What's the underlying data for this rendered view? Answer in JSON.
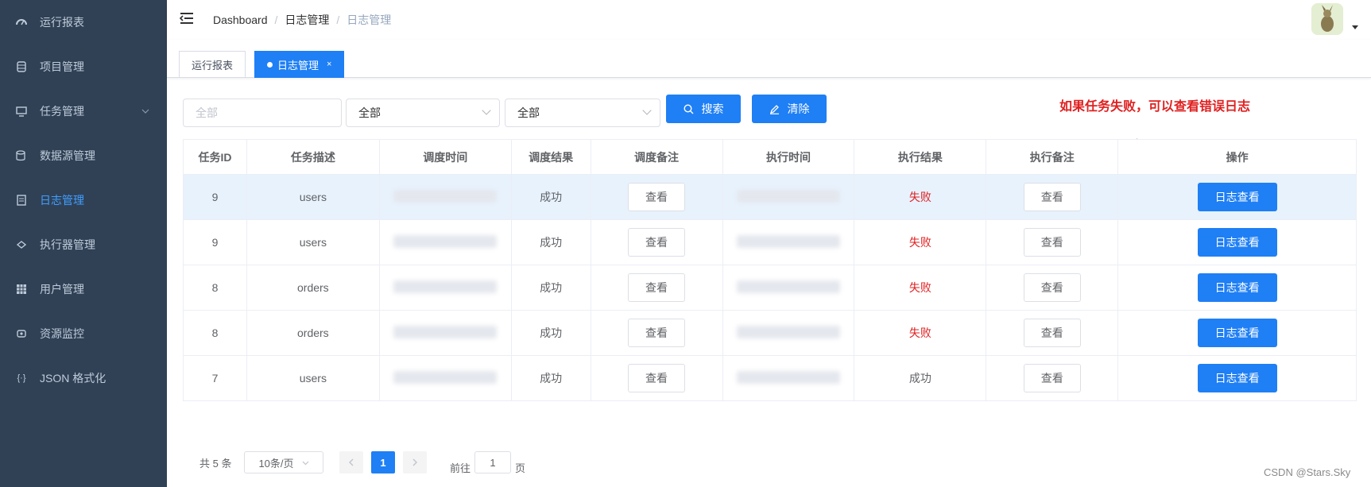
{
  "sidebar": {
    "items": [
      {
        "label": "运行报表",
        "icon": "dashboard-icon"
      },
      {
        "label": "项目管理",
        "icon": "database-icon"
      },
      {
        "label": "任务管理",
        "icon": "monitor-icon"
      },
      {
        "label": "数据源管理",
        "icon": "datasource-icon"
      },
      {
        "label": "日志管理",
        "icon": "document-icon"
      },
      {
        "label": "执行器管理",
        "icon": "executor-icon"
      },
      {
        "label": "用户管理",
        "icon": "table-icon"
      },
      {
        "label": "资源监控",
        "icon": "monitor-resource-icon"
      },
      {
        "label": "JSON 格式化",
        "icon": "braces-icon"
      }
    ],
    "active_index": 4
  },
  "navbar": {
    "breadcrumb": [
      "Dashboard",
      "日志管理",
      "日志管理"
    ]
  },
  "tags": [
    {
      "label": "运行报表",
      "active": false
    },
    {
      "label": "日志管理",
      "active": true,
      "close": "×"
    }
  ],
  "filters": {
    "input_placeholder": "全部",
    "select1_value": "全部",
    "select2_value": "全部",
    "search_label": "搜索",
    "clear_label": "清除"
  },
  "annotation": "如果任务失败，可以查看错误日志",
  "table": {
    "headers": [
      "任务ID",
      "任务描述",
      "调度时间",
      "调度结果",
      "调度备注",
      "执行时间",
      "执行结果",
      "执行备注",
      "操作"
    ],
    "view_label": "查看",
    "log_label": "日志查看",
    "rows": [
      {
        "id": "9",
        "desc": "users",
        "sched_result": "成功",
        "exec_result": "失败"
      },
      {
        "id": "9",
        "desc": "users",
        "sched_result": "成功",
        "exec_result": "失败"
      },
      {
        "id": "8",
        "desc": "orders",
        "sched_result": "成功",
        "exec_result": "失败"
      },
      {
        "id": "8",
        "desc": "orders",
        "sched_result": "成功",
        "exec_result": "失败"
      },
      {
        "id": "7",
        "desc": "users",
        "sched_result": "成功",
        "exec_result": "成功"
      }
    ]
  },
  "pagination": {
    "total": "共 5 条",
    "page_size": "10条/页",
    "current": "1",
    "goto_prefix": "前往",
    "goto_value": "1",
    "goto_suffix": "页"
  },
  "watermark": "CSDN @Stars.Sky",
  "colors": {
    "sidebar_bg": "#304156",
    "accent": "#1f7ff5",
    "fail": "#e02020"
  }
}
